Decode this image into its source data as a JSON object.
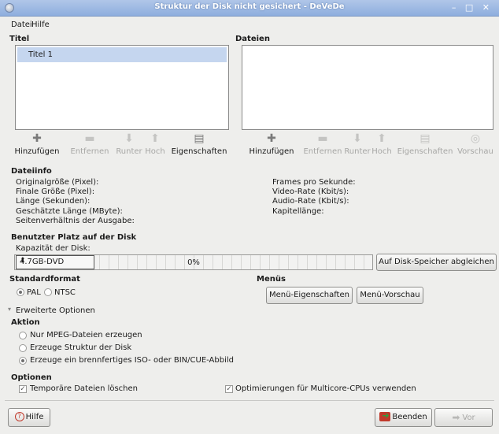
{
  "window": {
    "title": "Struktur der Disk nicht gesichert - DeVeDe",
    "controls": "– □ ✕"
  },
  "menu": {
    "file": "Datei",
    "help": "Hilfe"
  },
  "titles_panel": {
    "heading": "Titel",
    "items": [
      "Titel 1"
    ],
    "toolbar": {
      "add": "Hinzufügen",
      "remove": "Entfernen",
      "down": "Runter",
      "up": "Hoch",
      "properties": "Eigenschaften"
    }
  },
  "files_panel": {
    "heading": "Dateien",
    "toolbar": {
      "add": "Hinzufügen",
      "remove": "Entfernen",
      "down": "Runter",
      "up": "Hoch",
      "properties": "Eigenschaften",
      "preview": "Vorschau"
    }
  },
  "fileinfo": {
    "heading": "Dateiinfo",
    "left": [
      "Originalgröße (Pixel):",
      "Finale Größe (Pixel):",
      "Länge (Sekunden):",
      "Geschätzte Länge (MByte):",
      "Seitenverhältnis der Ausgabe:"
    ],
    "right": [
      "Frames pro Sekunde:",
      "Video-Rate (Kbit/s):",
      "Audio-Rate (Kbit/s):",
      "Kapitellänge:"
    ]
  },
  "disk": {
    "heading": "Benutzter Platz auf der Disk",
    "capacity_label": "Kapazität der Disk:",
    "capacity_value": "4.7GB-DVD",
    "usage_percent_text": "0%",
    "usage_fraction": 0,
    "adjust_button": "Auf Disk-Speicher abgleichen"
  },
  "standard": {
    "heading": "Standardformat",
    "pal": "PAL",
    "ntsc": "NTSC",
    "selected": "PAL"
  },
  "menus": {
    "heading": "Menüs",
    "properties_button": "Menü-Eigenschaften",
    "preview_button": "Menü-Vorschau"
  },
  "advanced": {
    "expander": "Erweiterte Optionen"
  },
  "action": {
    "heading": "Aktion",
    "options": [
      "Nur MPEG-Dateien erzeugen",
      "Erzeuge Struktur der Disk",
      "Erzeuge ein brennfertiges ISO- oder BIN/CUE-Abbild"
    ],
    "selected_index": 2
  },
  "options": {
    "heading": "Optionen",
    "delete_temp": "Temporäre Dateien löschen",
    "multicore": "Optimierungen für Multicore-CPUs verwenden"
  },
  "footer": {
    "help_button": "Hilfe",
    "quit_button": "Beenden",
    "forward_button": "Vor"
  },
  "colors": {
    "title_bar": "#9fb9e2",
    "selection": "#c5d6ef",
    "window_bg": "#eeeeec"
  }
}
